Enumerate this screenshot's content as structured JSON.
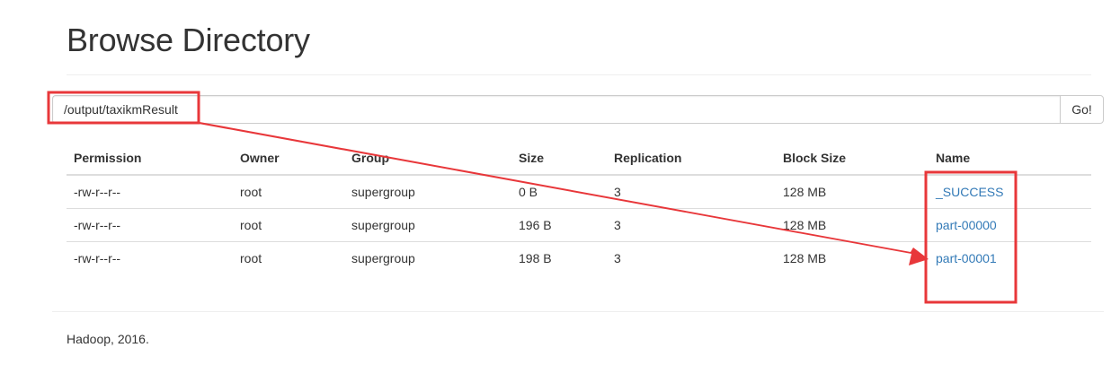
{
  "page": {
    "title": "Browse Directory"
  },
  "path_bar": {
    "value": "/output/taxikmResult",
    "go_label": "Go!"
  },
  "table": {
    "headers": [
      "Permission",
      "Owner",
      "Group",
      "Size",
      "Replication",
      "Block Size",
      "Name"
    ],
    "rows": [
      {
        "permission": "-rw-r--r--",
        "owner": "root",
        "group": "supergroup",
        "size": "0 B",
        "replication": "3",
        "block_size": "128 MB",
        "name": "_SUCCESS"
      },
      {
        "permission": "-rw-r--r--",
        "owner": "root",
        "group": "supergroup",
        "size": "196 B",
        "replication": "3",
        "block_size": "128 MB",
        "name": "part-00000"
      },
      {
        "permission": "-rw-r--r--",
        "owner": "root",
        "group": "supergroup",
        "size": "198 B",
        "replication": "3",
        "block_size": "128 MB",
        "name": "part-00001"
      }
    ]
  },
  "footer": {
    "text": "Hadoop, 2016."
  },
  "colors": {
    "link": "#337ab7",
    "annotation": "#e8373a"
  }
}
